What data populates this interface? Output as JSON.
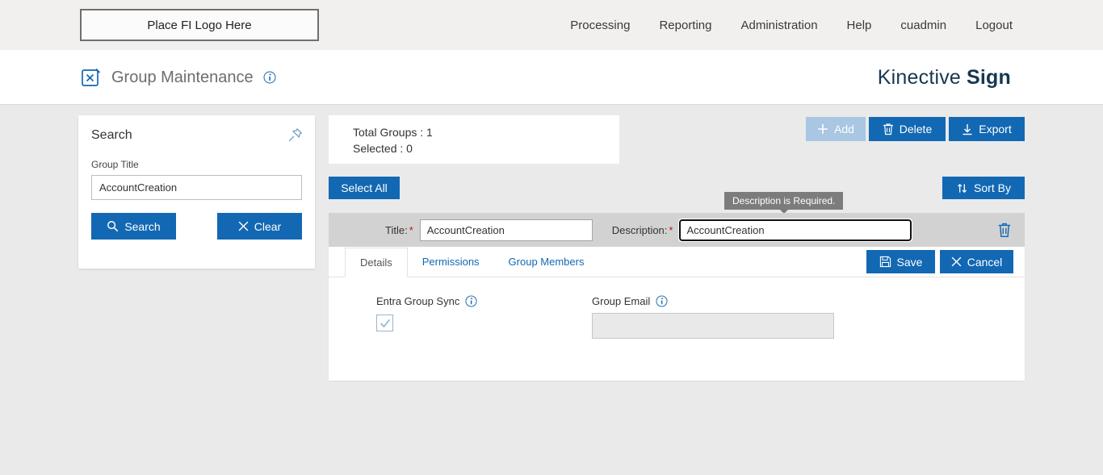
{
  "topbar": {
    "logo_placeholder": "Place FI Logo Here",
    "nav": [
      "Processing",
      "Reporting",
      "Administration",
      "Help",
      "cuadmin",
      "Logout"
    ]
  },
  "header": {
    "title": "Group Maintenance",
    "brand_name": "Kinective",
    "brand_suffix": "Sign"
  },
  "search_panel": {
    "title": "Search",
    "group_title_label": "Group Title",
    "group_title_value": "AccountCreation",
    "search_button": "Search",
    "clear_button": "Clear"
  },
  "summary": {
    "total_groups": "Total Groups : 1",
    "selected": "Selected : 0"
  },
  "toolbar": {
    "add_label": "Add",
    "delete_label": "Delete",
    "export_label": "Export",
    "select_all_label": "Select All",
    "sort_by_label": "Sort By"
  },
  "tooltip_text": "Description is Required.",
  "group_row": {
    "title_label": "Title:",
    "required_marker": "*",
    "title_value": "AccountCreation",
    "description_label": "Description:",
    "description_value": "AccountCreation"
  },
  "tabs": {
    "details": "Details",
    "permissions": "Permissions",
    "group_members": "Group Members"
  },
  "panel_actions": {
    "save_label": "Save",
    "cancel_label": "Cancel"
  },
  "details_tab": {
    "entra_label": "Entra Group Sync",
    "group_email_label": "Group Email",
    "entra_checked": true
  },
  "colors": {
    "primary_blue": "#1268b3",
    "brand_navy": "#16384f",
    "disabled_add": "#a9c6e3",
    "tooltip_gray": "#7c7c7c"
  }
}
